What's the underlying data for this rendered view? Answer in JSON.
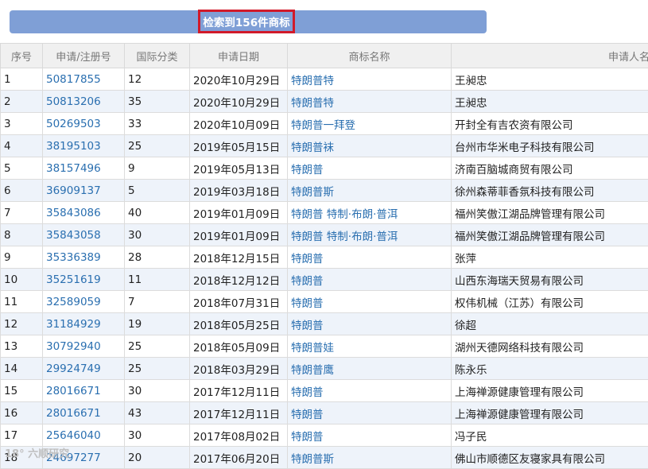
{
  "result": {
    "label": "检索到156件商标"
  },
  "table": {
    "headers": [
      "序号",
      "申请/注册号",
      "国际分类",
      "申请日期",
      "商标名称",
      "申请人名称"
    ],
    "rows": [
      {
        "no": "1",
        "reg": "50817855",
        "cls": "12",
        "date": "2020年10月29日",
        "name": "特朗普特",
        "applicant": "王昶忠"
      },
      {
        "no": "2",
        "reg": "50813206",
        "cls": "35",
        "date": "2020年10月29日",
        "name": "特朗普特",
        "applicant": "王昶忠"
      },
      {
        "no": "3",
        "reg": "50269503",
        "cls": "33",
        "date": "2020年10月09日",
        "name": "特朗普一拜登",
        "applicant": "开封全有吉农资有限公司"
      },
      {
        "no": "4",
        "reg": "38195103",
        "cls": "25",
        "date": "2019年05月15日",
        "name": "特朗普袜",
        "applicant": "台州市华米电子科技有限公司"
      },
      {
        "no": "5",
        "reg": "38157496",
        "cls": "9",
        "date": "2019年05月13日",
        "name": "特朗普",
        "applicant": "济南百脑城商贸有限公司"
      },
      {
        "no": "6",
        "reg": "36909137",
        "cls": "5",
        "date": "2019年03月18日",
        "name": "特朗普斯",
        "applicant": "徐州森蒂菲香氛科技有限公司"
      },
      {
        "no": "7",
        "reg": "35843086",
        "cls": "40",
        "date": "2019年01月09日",
        "name": "特朗普 特制·布朗·普洱",
        "applicant": "福州笑傲江湖品牌管理有限公司"
      },
      {
        "no": "8",
        "reg": "35843058",
        "cls": "30",
        "date": "2019年01月09日",
        "name": "特朗普 特制·布朗·普洱",
        "applicant": "福州笑傲江湖品牌管理有限公司"
      },
      {
        "no": "9",
        "reg": "35336389",
        "cls": "28",
        "date": "2018年12月15日",
        "name": "特朗普",
        "applicant": "张萍"
      },
      {
        "no": "10",
        "reg": "35251619",
        "cls": "11",
        "date": "2018年12月12日",
        "name": "特朗普",
        "applicant": "山西东海瑞天贸易有限公司"
      },
      {
        "no": "11",
        "reg": "32589059",
        "cls": "7",
        "date": "2018年07月31日",
        "name": "特朗普",
        "applicant": "权伟机械（江苏）有限公司"
      },
      {
        "no": "12",
        "reg": "31184929",
        "cls": "19",
        "date": "2018年05月25日",
        "name": "特朗普",
        "applicant": "徐超"
      },
      {
        "no": "13",
        "reg": "30792940",
        "cls": "25",
        "date": "2018年05月09日",
        "name": "特朗普娃",
        "applicant": "湖州天德网络科技有限公司"
      },
      {
        "no": "14",
        "reg": "29924749",
        "cls": "25",
        "date": "2018年03月29日",
        "name": "特朗普鹰",
        "applicant": "陈永乐"
      },
      {
        "no": "15",
        "reg": "28016671",
        "cls": "30",
        "date": "2017年12月11日",
        "name": "特朗普",
        "applicant": "上海禅源健康管理有限公司"
      },
      {
        "no": "16",
        "reg": "28016671",
        "cls": "43",
        "date": "2017年12月11日",
        "name": "特朗普",
        "applicant": "上海禅源健康管理有限公司"
      },
      {
        "no": "17",
        "reg": "25646040",
        "cls": "30",
        "date": "2017年08月02日",
        "name": "特朗普",
        "applicant": "冯子民"
      },
      {
        "no": "18",
        "reg": "24697277",
        "cls": "20",
        "date": "2017年06月20日",
        "name": "特朗普斯",
        "applicant": "佛山市顺德区友寝家具有限公司"
      }
    ]
  },
  "watermark": {
    "text": "18° 六顺研究"
  }
}
